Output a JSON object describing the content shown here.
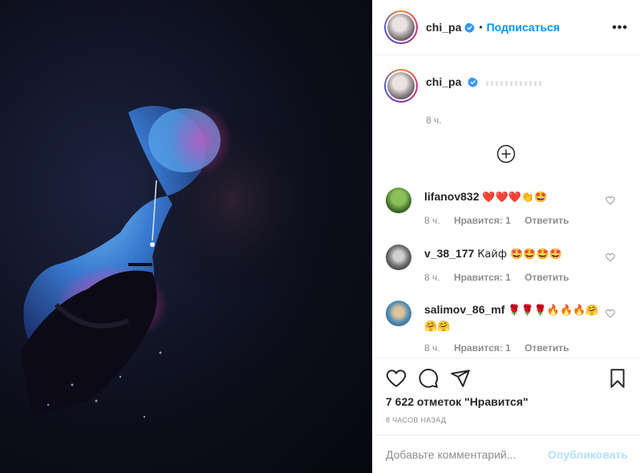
{
  "post": {
    "author": "chi_pa",
    "follow_label": "Подписаться",
    "dot": "•",
    "more_label": "•••"
  },
  "caption": {
    "author": "chi_pa",
    "time": "8 ч."
  },
  "comments": [
    {
      "author": "lifanov832",
      "text": "❤️❤️❤️👏🤩",
      "time": "8 ч.",
      "likes": "Нравится: 1",
      "reply": "Ответить"
    },
    {
      "author": "v_38_177",
      "text": "Кайф 🤩🤩🤩🤩",
      "time": "8 ч.",
      "likes": "Нравится: 1",
      "reply": "Ответить"
    },
    {
      "author": "salimov_86_mf",
      "text": "🌹🌹🌹🔥🔥🔥🤗🤗🤗",
      "time": "8 ч.",
      "likes": "Нравится: 1",
      "reply": "Ответить"
    }
  ],
  "footer": {
    "likes_count": "7 622 отметок \"Нравится\"",
    "posted_ago": "8 часов назад"
  },
  "add_comment": {
    "placeholder": "Добавьте комментарий...",
    "publish_label": "Опубликовать"
  },
  "colors": {
    "accent": "#0095f6",
    "publish_disabled": "#b2dffc",
    "muted": "#8e8e8e",
    "border": "#efefef"
  },
  "icons": [
    "verified-badge-icon",
    "more-options-icon",
    "load-more-comments-icon",
    "heart-icon",
    "comment-icon",
    "share-icon",
    "bookmark-icon"
  ]
}
